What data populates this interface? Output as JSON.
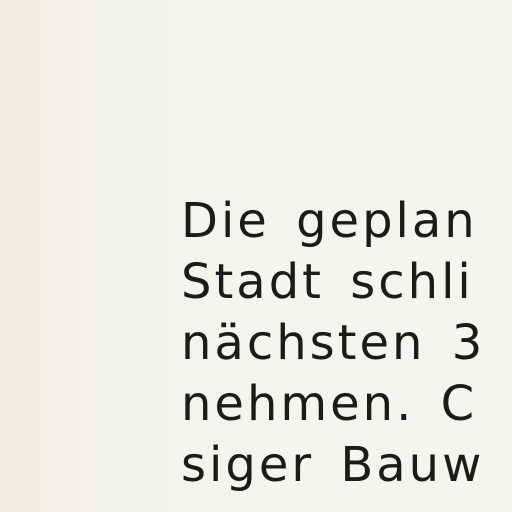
{
  "document": {
    "lines": [
      "Die geplan",
      "Stadt schli",
      "nächsten 3",
      "nehmen. C",
      "siger Bauw"
    ]
  }
}
